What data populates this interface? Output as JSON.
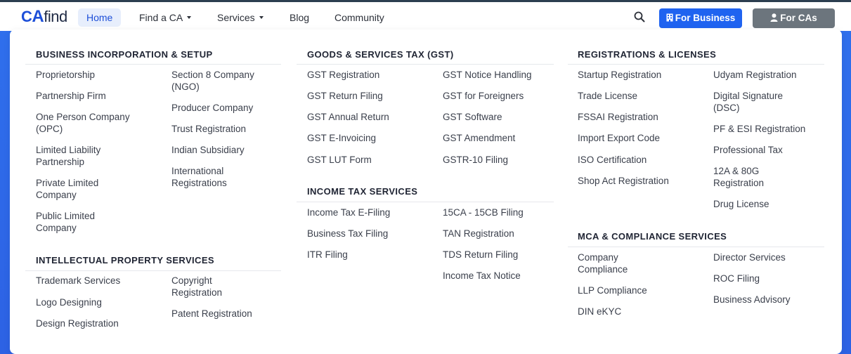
{
  "nav": {
    "logo": {
      "c": "C",
      "a": "A",
      "find": "find"
    },
    "items": [
      {
        "label": "Home",
        "active": true
      },
      {
        "label": "Find a CA",
        "dropdown": true
      },
      {
        "label": "Services",
        "dropdown": true
      },
      {
        "label": "Blog"
      },
      {
        "label": "Community"
      }
    ],
    "search_icon": "search-icon",
    "for_business": "For Business",
    "for_cas": "For CAs"
  },
  "colors": {
    "primary": "#1f63f0",
    "secondary": "#6c757d",
    "background": "#2f6fec"
  },
  "menu": {
    "business": {
      "title": "BUSINESS INCORPORATION & SETUP",
      "col1": [
        "Proprietorship",
        "Partnership Firm",
        "One Person Company\n(OPC)",
        "Limited Liability\nPartnership",
        "Private Limited\nCompany",
        "Public Limited\nCompany"
      ],
      "col2": [
        "Section 8 Company\n(NGO)",
        "Producer Company",
        "Trust Registration",
        "Indian Subsidiary",
        "International\nRegistrations"
      ]
    },
    "ip": {
      "title": "INTELLECTUAL PROPERTY SERVICES",
      "col1": [
        "Trademark Services",
        "Logo Designing",
        "Design Registration"
      ],
      "col2": [
        "Copyright\nRegistration",
        "Patent Registration"
      ]
    },
    "gst": {
      "title": "GOODS & SERVICES TAX (GST)",
      "col1": [
        "GST Registration",
        "GST Return Filing",
        "GST Annual Return",
        "GST E-Invoicing",
        "GST LUT Form"
      ],
      "col2": [
        "GST Notice Handling",
        "GST for Foreigners",
        "GST Software",
        "GST Amendment",
        "GSTR-10 Filing"
      ]
    },
    "income": {
      "title": "INCOME TAX SERVICES",
      "col1": [
        "Income Tax E-Filing",
        "Business Tax Filing",
        "ITR Filing"
      ],
      "col2": [
        "15CA - 15CB Filing",
        "TAN Registration",
        "TDS Return Filing",
        "Income Tax Notice"
      ]
    },
    "registrations": {
      "title": "REGISTRATIONS & LICENSES",
      "col1": [
        "Startup Registration",
        "Trade License",
        "FSSAI Registration",
        "Import Export Code",
        "ISO Certification",
        "Shop Act Registration"
      ],
      "col2": [
        "Udyam Registration",
        "Digital Signature\n(DSC)",
        "PF & ESI Registration",
        "Professional Tax",
        "12A & 80G\nRegistration",
        "Drug License"
      ]
    },
    "mca": {
      "title": "MCA & COMPLIANCE SERVICES",
      "col1": [
        "Company\nCompliance",
        "LLP Compliance",
        "DIN eKYC"
      ],
      "col2": [
        "Director Services",
        "ROC Filing",
        "Business Advisory"
      ]
    }
  }
}
